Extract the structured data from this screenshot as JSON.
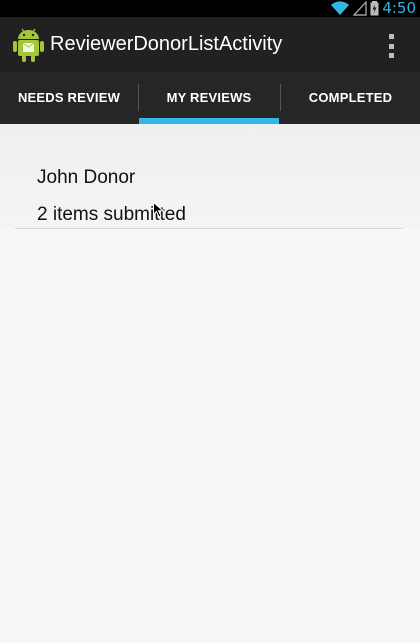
{
  "status_bar": {
    "time": "4:50",
    "icons": [
      "wifi-icon",
      "signal-icon",
      "battery-icon"
    ]
  },
  "action_bar": {
    "title": "ReviewerDonorListActivity",
    "icon": "android-app-icon",
    "menu_icon": "overflow-menu-icon"
  },
  "tabs": [
    {
      "label": "NEEDS REVIEW",
      "selected": false
    },
    {
      "label": "MY REVIEWS",
      "selected": true
    },
    {
      "label": "COMPLETED",
      "selected": false
    }
  ],
  "list": {
    "items": [
      {
        "name": "John Donor",
        "detail": "2 items submitted"
      }
    ]
  },
  "colors": {
    "accent": "#33b5e5",
    "action_bar": "#212121",
    "tab_bar": "#262626",
    "background": "#f7f7f7"
  }
}
